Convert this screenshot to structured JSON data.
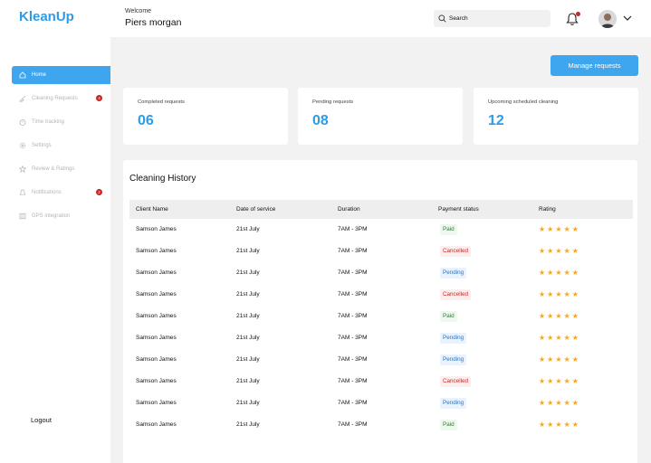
{
  "header": {
    "logo": "KleanUp",
    "welcome": "Welcome",
    "user_name": "Piers morgan",
    "search_placeholder": "Search",
    "notification_count": 1
  },
  "sidebar": {
    "items": [
      {
        "label": "Home",
        "icon": "home-icon",
        "active": true
      },
      {
        "label": "Cleaning Requests",
        "icon": "broom-icon",
        "badge": "4"
      },
      {
        "label": "Time tracking",
        "icon": "timer-icon"
      },
      {
        "label": "Settings",
        "icon": "gear-icon"
      },
      {
        "label": "Review & Ratings",
        "icon": "star-icon"
      },
      {
        "label": "Notifications",
        "icon": "bell-icon",
        "badge": "2"
      },
      {
        "label": "GPS integration",
        "icon": "map-icon"
      }
    ],
    "logout": "Logout"
  },
  "main": {
    "manage_button": "Manage requests",
    "stats": [
      {
        "label": "Completed requests",
        "value": "06"
      },
      {
        "label": "Pending requests",
        "value": "08"
      },
      {
        "label": "Upcoming scheduled cleaning",
        "value": "12"
      }
    ],
    "history": {
      "title": "Cleaning History",
      "columns": [
        "Client Name",
        "Date of service",
        "Duration",
        "Payment status",
        "Rating"
      ],
      "rows": [
        {
          "client": "Samson James",
          "date": "21st July",
          "duration": "7AM - 3PM",
          "status": "Paid",
          "stars": "★★★★★"
        },
        {
          "client": "Samson James",
          "date": "21st July",
          "duration": "7AM - 3PM",
          "status": "Cancelled",
          "stars": "★★★★★"
        },
        {
          "client": "Samson James",
          "date": "21st July",
          "duration": "7AM - 3PM",
          "status": "Pending",
          "stars": "★★★★★"
        },
        {
          "client": "Samson James",
          "date": "21st July",
          "duration": "7AM - 3PM",
          "status": "Cancelled",
          "stars": "★★★★★"
        },
        {
          "client": "Samson James",
          "date": "21st July",
          "duration": "7AM - 3PM",
          "status": "Paid",
          "stars": "★★★★★"
        },
        {
          "client": "Samson James",
          "date": "21st July",
          "duration": "7AM - 3PM",
          "status": "Pending",
          "stars": "★★★★★"
        },
        {
          "client": "Samson James",
          "date": "21st July",
          "duration": "7AM - 3PM",
          "status": "Pending",
          "stars": "★★★★★"
        },
        {
          "client": "Samson James",
          "date": "21st July",
          "duration": "7AM - 3PM",
          "status": "Cancelled",
          "stars": "★★★★★"
        },
        {
          "client": "Samson James",
          "date": "21st July",
          "duration": "7AM - 3PM",
          "status": "Pending",
          "stars": "★★★★★"
        },
        {
          "client": "Samson James",
          "date": "21st July",
          "duration": "7AM - 3PM",
          "status": "Paid",
          "stars": "★★★★★"
        }
      ]
    }
  },
  "colors": {
    "accent": "#3ea6ee",
    "paid": "#2e7d32",
    "cancelled": "#c62828",
    "pending": "#1976d2",
    "star": "#f5a623"
  }
}
